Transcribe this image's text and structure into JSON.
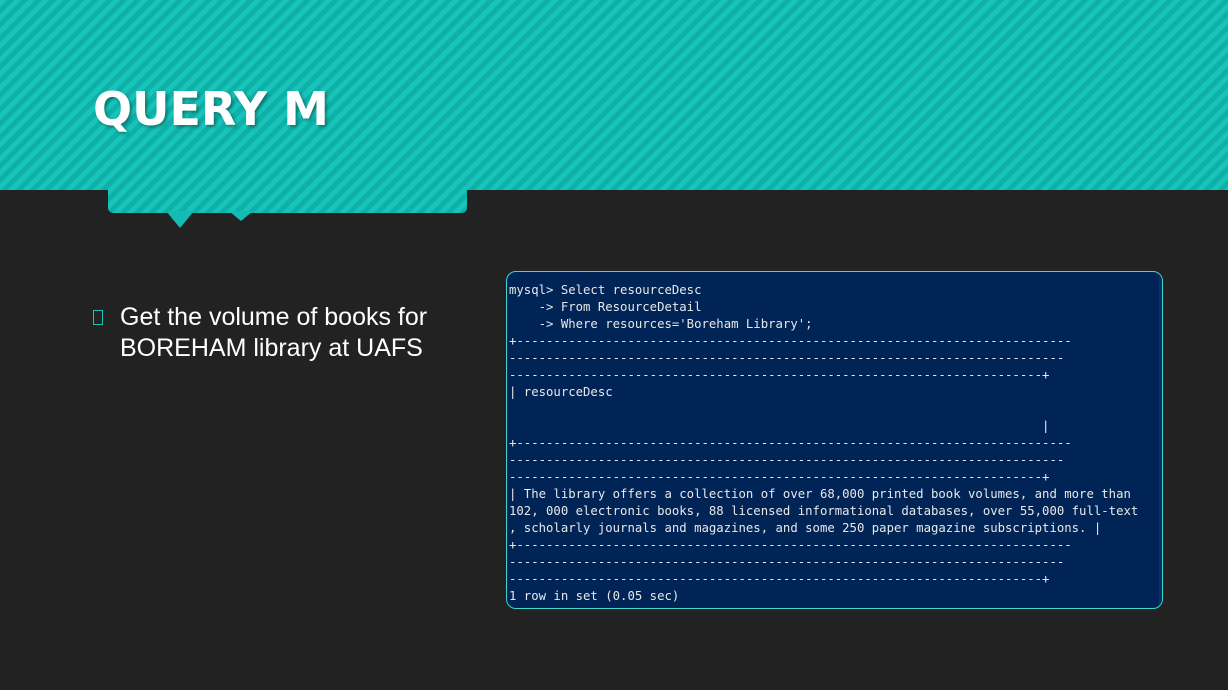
{
  "slide": {
    "title": "QUERY M",
    "bullet": "Get the volume of books for BOREHAM library at UAFS"
  },
  "colors": {
    "background": "#222222",
    "accent_teal": "#14bdb3",
    "terminal_bg": "#012456",
    "terminal_border": "#3fd6cc",
    "text": "#ffffff"
  },
  "terminal": {
    "lines": [
      "mysql> Select resourceDesc",
      "    -> From ResourceDetail",
      "    -> Where resources='Boreham Library';",
      "+---------------------------------------------------------------------------",
      "---------------------------------------------------------------------------",
      "------------------------------------------------------------------------+",
      "| resourceDesc",
      "",
      "                                                                        |",
      "+---------------------------------------------------------------------------",
      "---------------------------------------------------------------------------",
      "------------------------------------------------------------------------+",
      "| The library offers a collection of over 68,000 printed book volumes, and more than",
      "102, 000 electronic books, 88 licensed informational databases, over 55,000 full-text",
      ", scholarly journals and magazines, and some 250 paper magazine subscriptions. |",
      "+---------------------------------------------------------------------------",
      "---------------------------------------------------------------------------",
      "------------------------------------------------------------------------+",
      "1 row in set (0.05 sec)"
    ]
  }
}
